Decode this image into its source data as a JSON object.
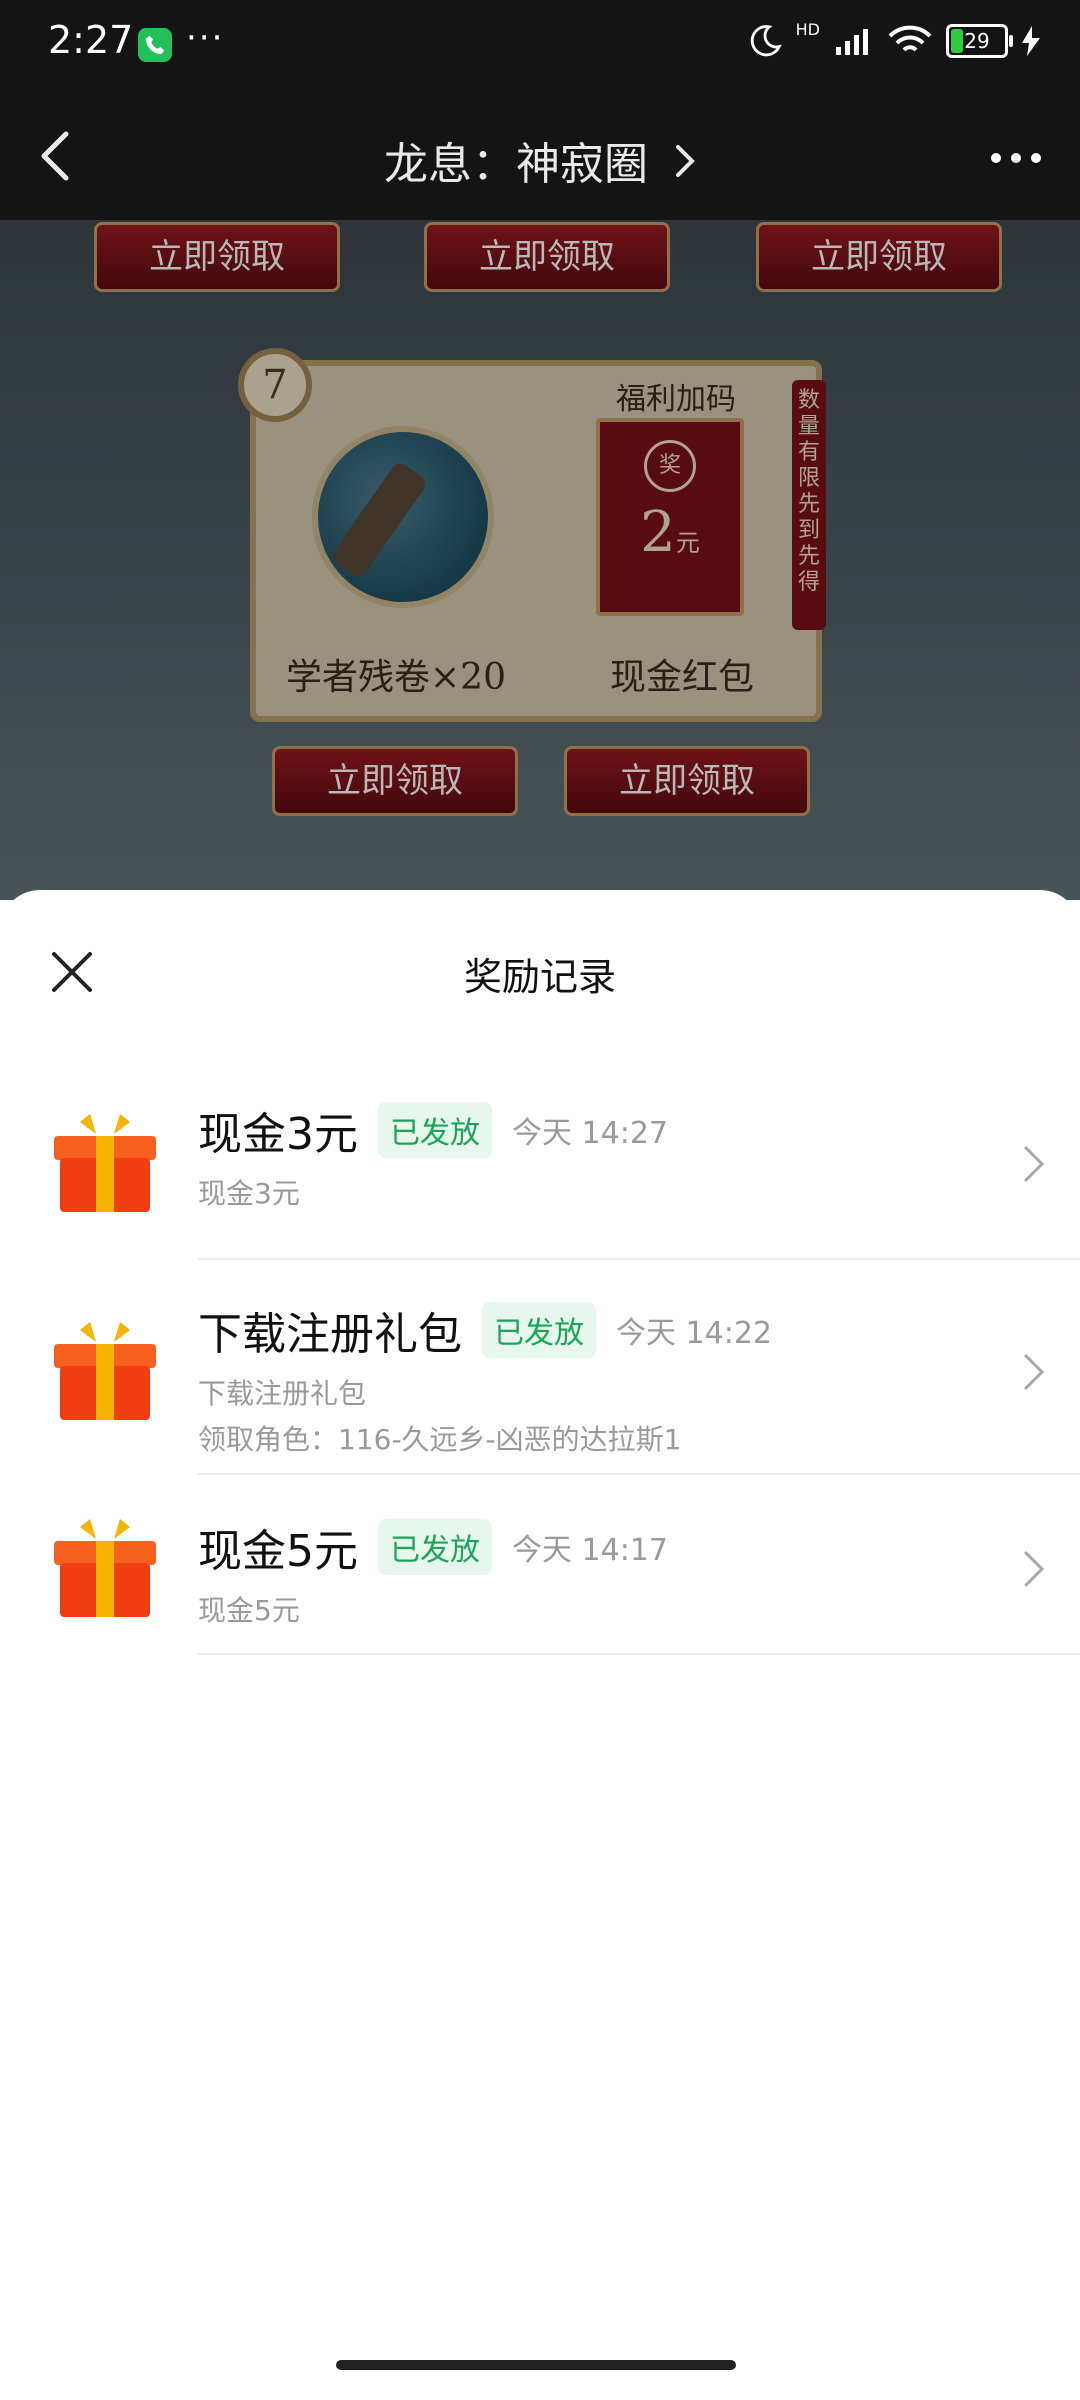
{
  "status": {
    "time": "2:27",
    "more_dots": "···",
    "battery": "29",
    "network": "HD"
  },
  "nav": {
    "title": "龙息：神寂圈"
  },
  "game": {
    "claim_label": "立即领取",
    "card_number": "7",
    "item_label": "学者残卷×20",
    "welfare_title": "福利加码",
    "redpacket_amount": "2",
    "redpacket_unit": "元",
    "redpacket_label": "现金红包",
    "limited_label": "数量有限先到先得",
    "seal_text": "奖"
  },
  "sheet": {
    "title": "奖励记录",
    "records": [
      {
        "title": "现金3元",
        "status": "已发放",
        "time": "今天 14:27",
        "desc": "现金3元",
        "extra": ""
      },
      {
        "title": "下载注册礼包",
        "status": "已发放",
        "time": "今天 14:22",
        "desc": "下载注册礼包",
        "extra": "领取角色：116-久远乡-凶恶的达拉斯1"
      },
      {
        "title": "现金5元",
        "status": "已发放",
        "time": "今天 14:17",
        "desc": "现金5元",
        "extra": ""
      }
    ]
  },
  "colors": {
    "badge_green": "#1aa55a",
    "header_dark": "#141414"
  },
  "icons": [
    "back-icon",
    "chevron-right-icon",
    "more-icon",
    "close-icon",
    "gift-icon",
    "phone-icon",
    "moon-icon",
    "signal-icon",
    "wifi-icon",
    "battery-icon",
    "charging-icon"
  ]
}
